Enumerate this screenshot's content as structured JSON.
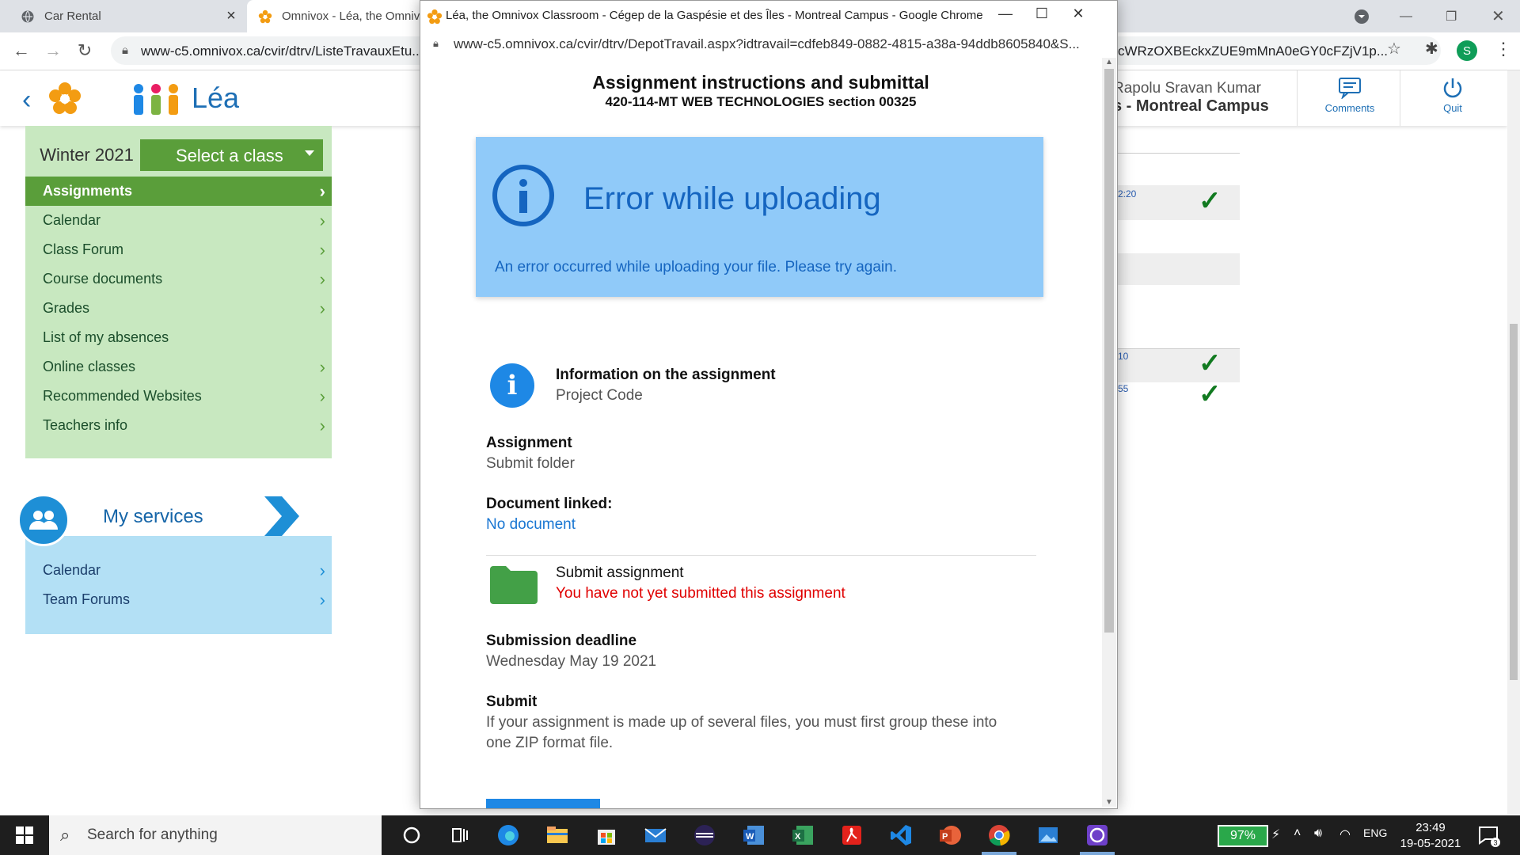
{
  "browser": {
    "tabs": [
      {
        "title": "Car Rental"
      },
      {
        "title": "Omnivox - Léa, the Omniv"
      }
    ],
    "url": "www-c5.omnivox.ca/cvir/dtrv/ListeTravauxEtu...",
    "url_right": "cWRzOXBEckxZUE9mMnA0eGY0cFZjV1p...",
    "profile_initial": "S"
  },
  "lea": {
    "title": "Léa",
    "user_name": "Rapolu Sravan Kumar",
    "campus": "s - Montreal Campus",
    "comments_label": "Comments",
    "quit_label": "Quit",
    "term": "Winter 2021",
    "select_class": "Select a class",
    "menu": [
      {
        "label": "Assignments",
        "active": true
      },
      {
        "label": "Calendar"
      },
      {
        "label": "Class Forum"
      },
      {
        "label": "Course documents"
      },
      {
        "label": "Grades"
      },
      {
        "label": "List of my absences"
      },
      {
        "label": "Online classes"
      },
      {
        "label": "Recommended Websites"
      },
      {
        "label": "Teachers info"
      }
    ],
    "services_title": "My services",
    "services": [
      {
        "label": "Calendar"
      },
      {
        "label": "Team Forums"
      }
    ],
    "right_times": [
      "2:20",
      "10",
      "55"
    ]
  },
  "popup": {
    "window_title": "Léa, the Omnivox Classroom - Cégep de la Gaspésie et des Îles - Montreal Campus - Google Chrome",
    "url": "www-c5.omnivox.ca/cvir/dtrv/DepotTravail.aspx?idtravail=cdfeb849-0882-4815-a38a-94ddb8605840&S...",
    "heading": "Assignment instructions and submittal",
    "course": "420-114-MT WEB TECHNOLOGIES section 00325",
    "alert_title": "Error while uploading",
    "alert_message": "An error occurred while uploading your file. Please try again.",
    "info_label": "Information on the assignment",
    "info_value": "Project Code",
    "assignment_label": "Assignment",
    "assignment_value": "Submit folder",
    "doc_label": "Document linked:",
    "doc_value": "No document",
    "submit_assignment_label": "Submit assignment",
    "submit_status": "You have not yet submitted this assignment",
    "deadline_label": "Submission deadline",
    "deadline_value": "Wednesday May 19 2021",
    "submit_label": "Submit",
    "submit_text_1": "If your assignment is made up of several files, you must first group these into",
    "submit_text_2": "one ZIP format file."
  },
  "taskbar": {
    "search_placeholder": "Search for anything",
    "battery": "97%",
    "language": "ENG",
    "time": "23:49",
    "date": "19-05-2021",
    "notifications": "3"
  },
  "colors": {
    "lea_blue": "#1e6fb5",
    "menu_green": "#5a9e3a",
    "sidebar_green": "#c8e8c0",
    "services_blue": "#b3e0f5",
    "alert_bg": "#90caf9",
    "alert_text": "#1565c0",
    "error_red": "#e00000"
  }
}
